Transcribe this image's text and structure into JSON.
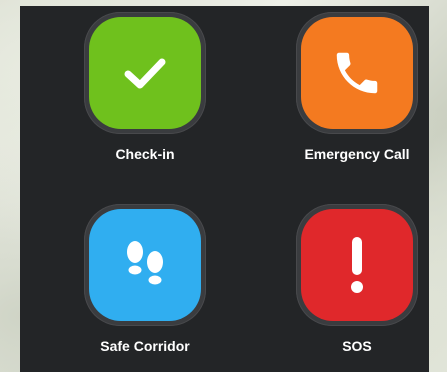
{
  "buttons": [
    {
      "id": "check-in",
      "label": "Check-in",
      "color": "#6fc11d",
      "icon": "checkmark-icon"
    },
    {
      "id": "emergency-call",
      "label": "Emergency Call",
      "color": "#f47a20",
      "icon": "phone-icon"
    },
    {
      "id": "safe-corridor",
      "label": "Safe Corridor",
      "color": "#30aef0",
      "icon": "footprints-icon"
    },
    {
      "id": "sos",
      "label": "SOS",
      "color": "#e0282b",
      "icon": "exclamation-icon"
    }
  ],
  "colors": {
    "panel_background": "#232527",
    "button_bezel": "#3a3c3f",
    "label_text": "#ffffff"
  }
}
